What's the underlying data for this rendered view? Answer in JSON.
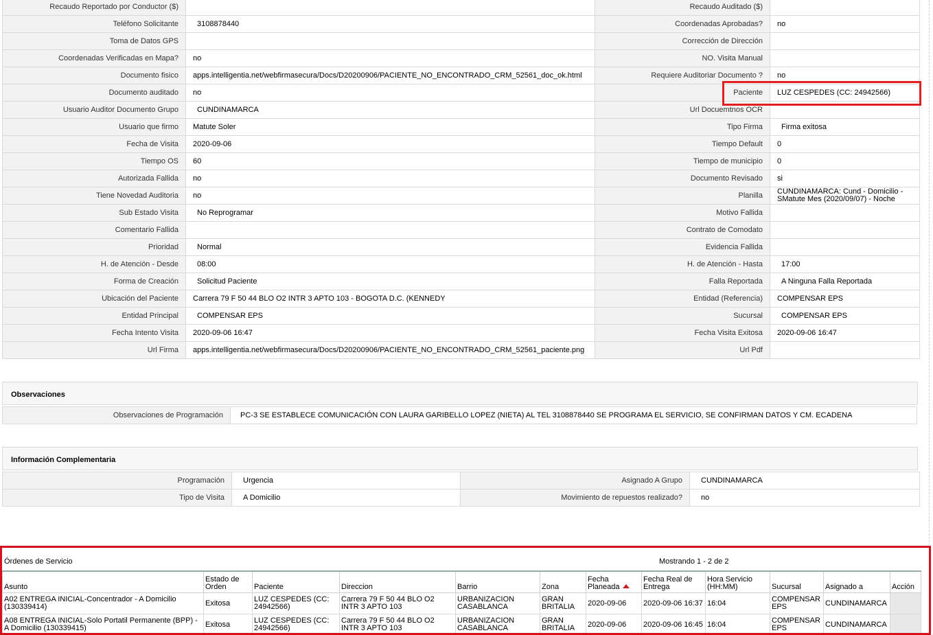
{
  "details": [
    [
      "Recaudo Reportado por Conductor ($)",
      "",
      "Recaudo Auditado ($)",
      ""
    ],
    [
      "Teléfono Solicitante",
      "3108878440",
      "Coordenadas Aprobadas?",
      "no"
    ],
    [
      "Toma de Datos GPS",
      "",
      "Corrección de Dirección",
      ""
    ],
    [
      "Coordenadas Verificadas en Mapa?",
      "no",
      "NO. Visita Manual",
      ""
    ],
    [
      "Documento fisico",
      "apps.intelligentia.net/webfirmasecura/Docs/D20200906/PACIENTE_NO_ENCONTRADO_CRM_52561_doc_ok.html",
      "Requiere Auditoriar Documento ?",
      "no"
    ],
    [
      "Documento auditado",
      "no",
      "Paciente",
      "LUZ CESPEDES (CC: 24942566)"
    ],
    [
      "Usuario Auditor Documento Grupo",
      "CUNDINAMARCA",
      "Url Docuemtnos OCR",
      ""
    ],
    [
      "Usuario que firmo",
      "Matute Soler",
      "Tipo Firma",
      "Firma exitosa"
    ],
    [
      "Fecha de Visita",
      "2020-09-06",
      "Tiempo Default",
      "0"
    ],
    [
      "Tiempo OS",
      "60",
      "Tiempo de municipio",
      "0"
    ],
    [
      "Autorizada Fallida",
      "no",
      "Documento Revisado",
      "si"
    ],
    [
      "Tiene Novedad Auditoria",
      "no",
      "Planilla",
      "CUNDINAMARCA: Cund - Domicilio - SMatute Mes (2020/09/07) - Noche"
    ],
    [
      "Sub Estado Visita",
      "No Reprogramar",
      "Motivo Fallida",
      ""
    ],
    [
      "Comentario Fallida",
      "",
      "Contrato de Comodato",
      ""
    ],
    [
      "Prioridad",
      "Normal",
      "Evidencia Fallida",
      ""
    ],
    [
      "H. de Atención - Desde",
      "08:00",
      "H. de Atención - Hasta",
      "17:00"
    ],
    [
      "Forma de Creación",
      "Solicitud Paciente",
      "Falla Reportada",
      "A Ninguna Falla Reportada"
    ],
    [
      "Ubicación del Paciente",
      "Carrera 79 F 50 44 BLO O2 INTR 3 APTO 103 - BOGOTA D.C. (KENNEDY",
      "Entidad (Referencia)",
      "COMPENSAR EPS"
    ],
    [
      "Entidad Principal",
      "COMPENSAR EPS",
      "Sucursal",
      "COMPENSAR EPS"
    ],
    [
      "Fecha Intento Visita",
      "2020-09-06 16:47",
      "Fecha Visita Exitosa",
      "2020-09-06 16:47"
    ],
    [
      "Url Firma",
      "apps.intelligentia.net/webfirmasecura/Docs/D20200906/PACIENTE_NO_ENCONTRADO_CRM_52561_paciente.png",
      "Url Pdf",
      ""
    ]
  ],
  "observaciones": {
    "title": "Observaciones",
    "label": "Observaciones de Programación",
    "value": "PC-3 SE ESTABLECE COMUNICACIÓN CON LAURA GARIBELLO LOPEZ (NIETA) AL TEL 3108878440 SE PROGRAMA EL SERVICIO, SE CONFIRMAN DATOS Y CM. ECADENA"
  },
  "complementaria": {
    "title": "Información Complementaria",
    "rows": [
      [
        "Programación",
        "Urgencia",
        "Asignado A Grupo",
        "CUNDINAMARCA"
      ],
      [
        "Tipo de Visita",
        "A Domicilio",
        "Movimiento de repuestos realizado?",
        "no"
      ]
    ]
  },
  "ordenes": {
    "title": "Órdenes de Servicio",
    "count_text": "Mostrando 1 - 2 de 2",
    "columns": [
      "Asunto",
      "Estado de Orden",
      "Paciente",
      "Direccion",
      "Barrio",
      "Zona",
      "Fecha Planeada",
      "Fecha Real de Entrega",
      "Hora Servicio (HH:MM)",
      "Sucursal",
      "Asignado a",
      "Acción"
    ],
    "rows": [
      [
        "A02 ENTREGA INICIAL-Concentrador - A Domicilio (130339414)",
        "Exitosa",
        "LUZ CESPEDES (CC: 24942566)",
        "Carrera 79 F 50 44 BLO O2 INTR 3 APTO 103",
        "URBANIZACION CASABLANCA",
        "GRAN BRITALIA",
        "2020-09-06",
        "2020-09-06 16:37",
        "16:04",
        "COMPENSAR EPS",
        "CUNDINAMARCA",
        ""
      ],
      [
        "A08 ENTREGA INICIAL-Solo Portatil Permanente (BPP) - A Domicilio (130339415)",
        "Exitosa",
        "LUZ CESPEDES (CC: 24942566)",
        "Carrera 79 F 50 44 BLO O2 INTR 3 APTO 103",
        "URBANIZACION CASABLANCA",
        "GRAN BRITALIA",
        "2020-09-06",
        "2020-09-06 16:45",
        "16:04",
        "COMPENSAR EPS",
        "CUNDINAMARCA",
        ""
      ]
    ]
  },
  "colors": {
    "highlight": "#e02020",
    "label_bg": "#f2f2f2",
    "border": "#dadada"
  }
}
